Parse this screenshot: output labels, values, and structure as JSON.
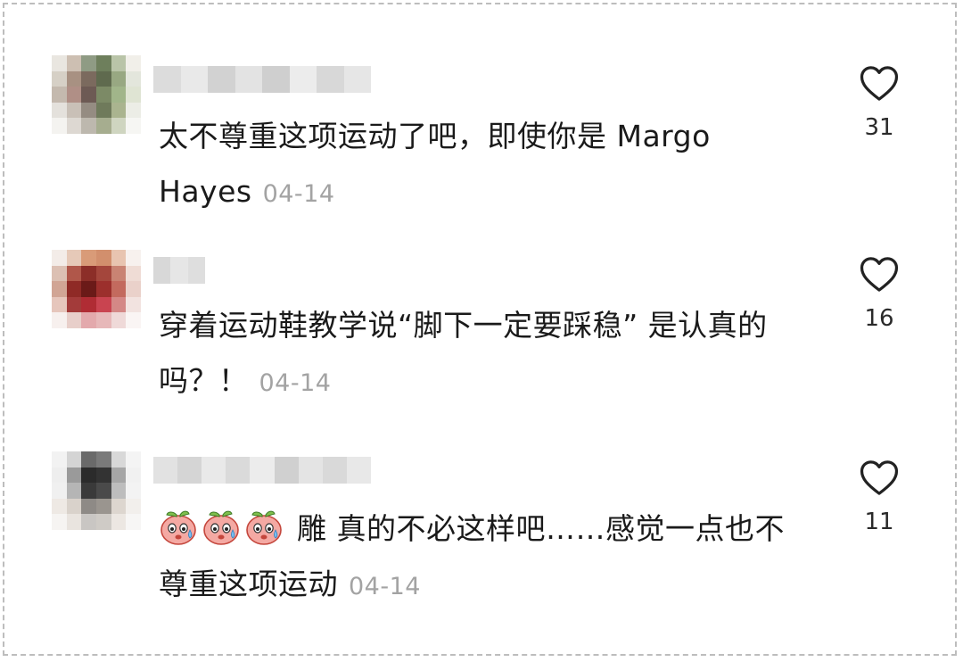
{
  "comments": [
    {
      "text": "太不尊重这项运动了吧，即使你是 Margo Hayes",
      "date": "04-14",
      "likes": "31",
      "avatar_colors": [
        "#e9e6e0",
        "#cdbfb2",
        "#8f9b84",
        "#6e7f5c",
        "#b9c4a8",
        "#f1efe9",
        "#d6d0c6",
        "#a89182",
        "#7b6a5e",
        "#5f6a4e",
        "#98a882",
        "#e3e6dc",
        "#c4b9ae",
        "#b08f86",
        "#6d5a54",
        "#7c8a66",
        "#a1b58a",
        "#dfe4d3",
        "#e4e1dc",
        "#c9c0b7",
        "#958c82",
        "#6f7a5b",
        "#aab48f",
        "#ecede6",
        "#f4f3f0",
        "#ddd8d2",
        "#bdb8ae",
        "#a6ad8f",
        "#cfd5c0",
        "#f6f6f3"
      ],
      "name_blur": [
        "#dcdcdc",
        "#e9e9e9",
        "#d2d2d2",
        "#e3e3e3",
        "#cfcfcf",
        "#ececec",
        "#d8d8d8",
        "#e6e6e6"
      ]
    },
    {
      "text": "穿着运动鞋教学说“脚下一定要踩稳” 是认真的吗？！",
      "date": "04-14",
      "likes": "16",
      "avatar_colors": [
        "#f3ece8",
        "#e6c9b8",
        "#d99b78",
        "#d28f6d",
        "#e8c4b0",
        "#f7f1ee",
        "#dcc0b3",
        "#b0574a",
        "#8c2e28",
        "#a4463c",
        "#c98373",
        "#efdcd5",
        "#d1a595",
        "#8f2a26",
        "#6b1a18",
        "#9c2f2c",
        "#c36a5e",
        "#ead1ca",
        "#e6c6bc",
        "#a33b3a",
        "#b02c34",
        "#c94450",
        "#d48886",
        "#f2e3e0",
        "#f7f0ee",
        "#e8cfca",
        "#e3a9ac",
        "#e7b8b9",
        "#efd9d8",
        "#faf5f4"
      ],
      "name_blur": [
        "#d8d8d8",
        "#e6e6e6",
        "#dedede"
      ]
    },
    {
      "text": "雕 真的不必这样吧……感觉一点也不尊重这项运动",
      "date": "04-14",
      "likes": "11",
      "emoji_count": 3,
      "avatar_colors": [
        "#f2f2f2",
        "#d4d4d4",
        "#6a6a6a",
        "#7a7a7a",
        "#d8d8d8",
        "#f4f4f4",
        "#eeeeee",
        "#9a9a9a",
        "#2b2b2b",
        "#333333",
        "#a6a6a6",
        "#f1f1f1",
        "#f0f0f0",
        "#b5b5b5",
        "#3a3a3a",
        "#4a4a4a",
        "#bdbdbd",
        "#f3f3f3",
        "#eee9e4",
        "#d9d2cb",
        "#8e8a86",
        "#9a958f",
        "#ddd6cf",
        "#f2efec",
        "#f6f4f2",
        "#e9e4df",
        "#c9c6c3",
        "#cfcbc6",
        "#ece7e2",
        "#f7f6f5"
      ],
      "name_blur": [
        "#e2e2e2",
        "#d5d5d5",
        "#e9e9e9",
        "#dadada",
        "#ececec",
        "#d0d0d0",
        "#e4e4e4",
        "#d9d9d9",
        "#e8e8e8"
      ]
    }
  ],
  "icons": {
    "like": "heart-outline-icon",
    "emoji": "crying-peach-emoji-icon"
  },
  "colors": {
    "text": "#1a1a1a",
    "date": "#a3a3a3",
    "border": "#bdbdbd"
  }
}
